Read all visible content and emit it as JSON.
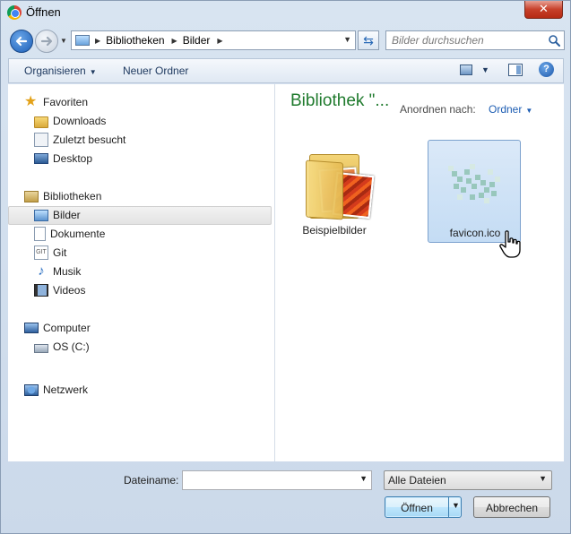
{
  "window": {
    "title": "Öffnen",
    "close_label": "✕"
  },
  "address": {
    "crumbs": [
      "Bibliotheken",
      "Bilder"
    ]
  },
  "search": {
    "placeholder": "Bilder durchsuchen"
  },
  "toolbar": {
    "organise_label": "Organisieren",
    "new_folder_label": "Neuer Ordner",
    "help_label": "?"
  },
  "sidebar": {
    "items": [
      {
        "label": "Favoriten",
        "icon": "star-icon"
      },
      {
        "label": "Downloads",
        "icon": "downloads-folder-icon"
      },
      {
        "label": "Zuletzt besucht",
        "icon": "recent-places-icon"
      },
      {
        "label": "Desktop",
        "icon": "desktop-icon"
      },
      {
        "label": "Bibliotheken",
        "icon": "libraries-icon"
      },
      {
        "label": "Bilder",
        "icon": "pictures-library-icon",
        "selected": true
      },
      {
        "label": "Dokumente",
        "icon": "documents-icon"
      },
      {
        "label": "Git",
        "icon": "git-icon"
      },
      {
        "label": "Musik",
        "icon": "music-icon"
      },
      {
        "label": "Videos",
        "icon": "videos-icon"
      },
      {
        "label": "Computer",
        "icon": "computer-icon"
      },
      {
        "label": "OS (C:)",
        "icon": "drive-icon"
      },
      {
        "label": "Netzwerk",
        "icon": "network-icon"
      }
    ]
  },
  "content": {
    "library_title": "Bibliothek \"...",
    "arrange_label": "Anordnen nach:",
    "arrange_value": "Ordner",
    "files": [
      {
        "name": "Beispielbilder",
        "icon": "folder-icon"
      },
      {
        "name": "favicon.ico",
        "icon": "image-file-icon",
        "selected": true
      }
    ]
  },
  "footer": {
    "filename_label": "Dateiname:",
    "filename_value": "",
    "filter_value": "Alle Dateien",
    "open_label": "Öffnen",
    "cancel_label": "Abbrechen"
  },
  "colors": {
    "library_title": "#1f7a2d",
    "link_blue": "#1d5db3",
    "selection": "#c4dcf4"
  }
}
